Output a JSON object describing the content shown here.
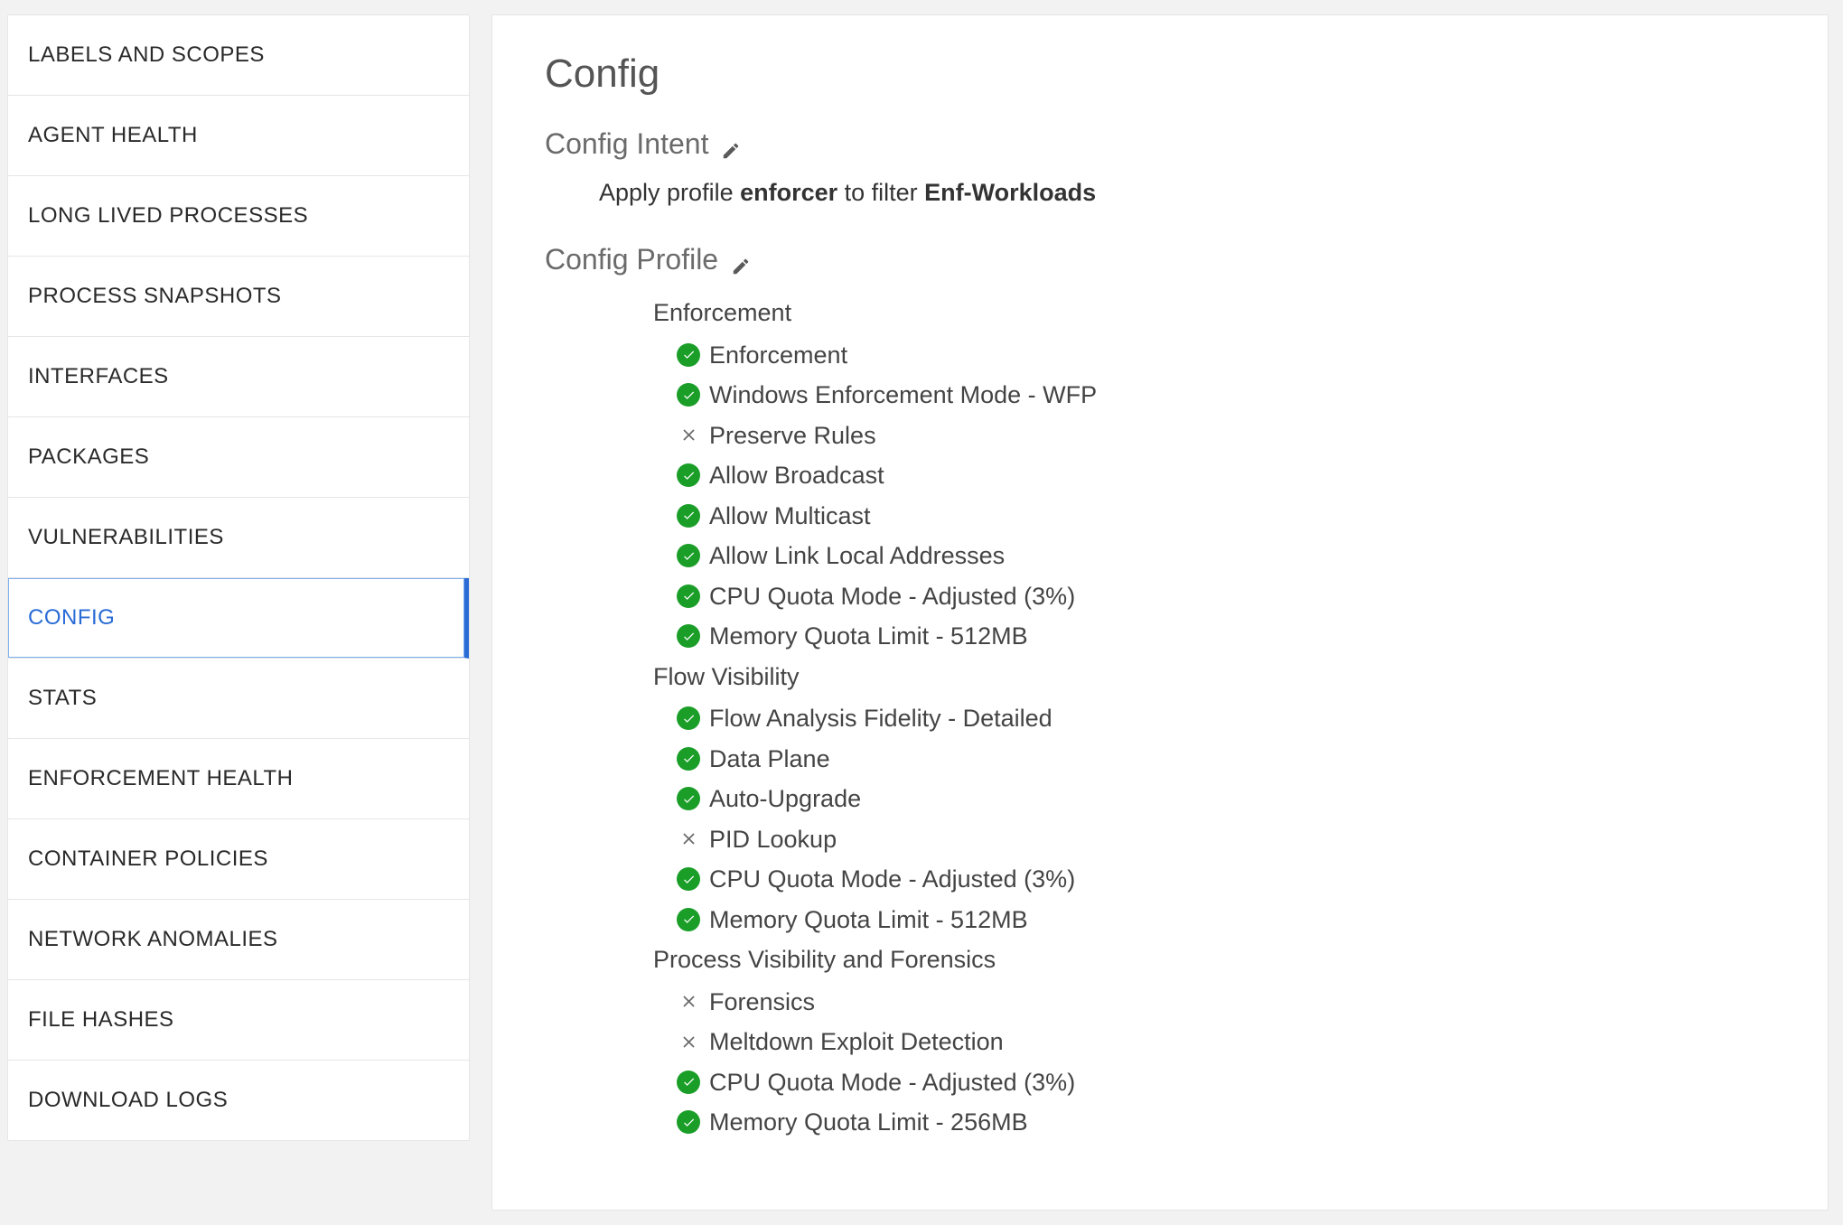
{
  "sidebar": {
    "items": [
      {
        "label": "LABELS AND SCOPES"
      },
      {
        "label": "AGENT HEALTH"
      },
      {
        "label": "LONG LIVED PROCESSES"
      },
      {
        "label": "PROCESS SNAPSHOTS"
      },
      {
        "label": "INTERFACES"
      },
      {
        "label": "PACKAGES"
      },
      {
        "label": "VULNERABILITIES"
      },
      {
        "label": "CONFIG"
      },
      {
        "label": "STATS"
      },
      {
        "label": "ENFORCEMENT HEALTH"
      },
      {
        "label": "CONTAINER POLICIES"
      },
      {
        "label": "NETWORK ANOMALIES"
      },
      {
        "label": "FILE HASHES"
      },
      {
        "label": "DOWNLOAD LOGS"
      }
    ],
    "activeIndex": 7
  },
  "main": {
    "title": "Config",
    "intentHeading": "Config Intent",
    "intentText": {
      "prefix": "Apply profile ",
      "profile": "enforcer",
      "middle": " to filter ",
      "filter": "Enf-Workloads"
    },
    "profileHeading": "Config Profile",
    "groups": [
      {
        "title": "Enforcement",
        "items": [
          {
            "status": "check",
            "label": "Enforcement"
          },
          {
            "status": "check",
            "label": "Windows Enforcement Mode - WFP"
          },
          {
            "status": "x",
            "label": "Preserve Rules"
          },
          {
            "status": "check",
            "label": "Allow Broadcast"
          },
          {
            "status": "check",
            "label": "Allow Multicast"
          },
          {
            "status": "check",
            "label": "Allow Link Local Addresses"
          },
          {
            "status": "check",
            "label": "CPU Quota Mode - Adjusted (3%)"
          },
          {
            "status": "check",
            "label": "Memory Quota Limit - 512MB"
          }
        ]
      },
      {
        "title": "Flow Visibility",
        "items": [
          {
            "status": "check",
            "label": "Flow Analysis Fidelity - Detailed"
          },
          {
            "status": "check",
            "label": "Data Plane"
          },
          {
            "status": "check",
            "label": "Auto-Upgrade"
          },
          {
            "status": "x",
            "label": "PID Lookup"
          },
          {
            "status": "check",
            "label": "CPU Quota Mode - Adjusted (3%)"
          },
          {
            "status": "check",
            "label": "Memory Quota Limit - 512MB"
          }
        ]
      },
      {
        "title": "Process Visibility and Forensics",
        "items": [
          {
            "status": "x",
            "label": "Forensics"
          },
          {
            "status": "x",
            "label": "Meltdown Exploit Detection"
          },
          {
            "status": "check",
            "label": "CPU Quota Mode - Adjusted (3%)"
          },
          {
            "status": "check",
            "label": "Memory Quota Limit - 256MB"
          }
        ]
      }
    ]
  }
}
